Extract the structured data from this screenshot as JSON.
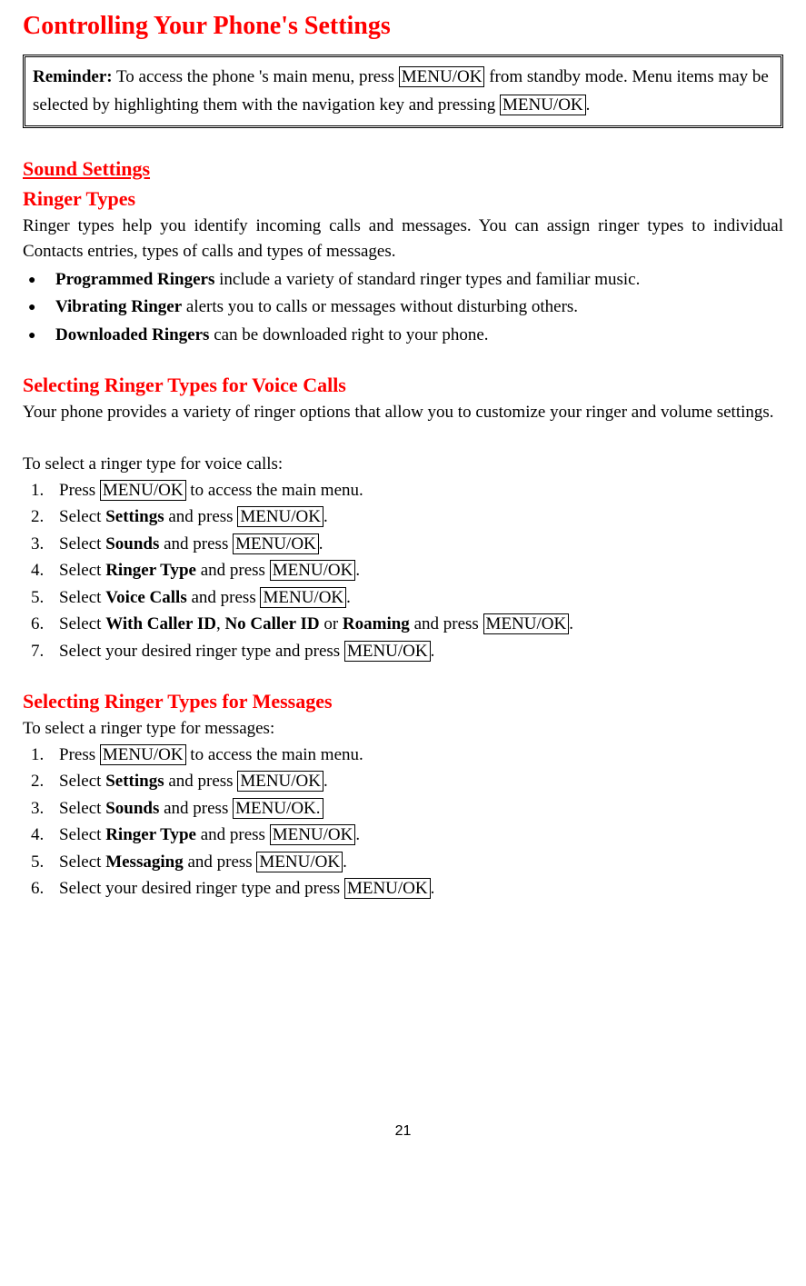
{
  "title": "Controlling Your Phone's Settings",
  "reminder": {
    "label": "Reminder:",
    "part1": " To access the phone 's main menu, press ",
    "key1": "MENU/OK",
    "part2": " from standby mode. Menu items may be selected by highlighting them with the navigation key and pressing ",
    "key2": "MENU/OK",
    "part3": "."
  },
  "sound_heading": "Sound Settings",
  "ringer_heading": "Ringer Types",
  "ringer_intro": "Ringer types help you identify incoming calls and messages. You can assign ringer types to individual Contacts entries, types of calls and types of messages.",
  "bullets": [
    {
      "bold": "Programmed Ringers",
      "rest": " include a variety of standard ringer types and familiar music."
    },
    {
      "bold": "Vibrating Ringer",
      "rest": " alerts you to calls or messages without disturbing others."
    },
    {
      "bold": "Downloaded Ringers",
      "rest": " can be downloaded right to your phone."
    }
  ],
  "voice_heading": "Selecting Ringer Types for Voice Calls",
  "voice_intro": "Your phone provides a variety of ringer options that allow you to customize your ringer and volume settings.",
  "voice_lead": "To select a ringer type for voice calls:",
  "voice_steps": {
    "s1a": "Press ",
    "s1k": "MENU/OK",
    "s1b": " to access the main menu.",
    "s2a": "Select ",
    "s2bold": "Settings",
    "s2b": " and press ",
    "s2k": "MENU/OK",
    "s2c": ".",
    "s3a": "Select ",
    "s3bold": "Sounds",
    "s3b": " and press ",
    "s3k": "MENU/OK",
    "s3c": ".",
    "s4a": "Select ",
    "s4bold": "Ringer Type",
    "s4b": " and press ",
    "s4k": "MENU/OK",
    "s4c": ".",
    "s5a": "Select ",
    "s5bold": "Voice Calls",
    "s5b": " and press ",
    "s5k": "MENU/OK",
    "s5c": ".",
    "s6a": "Select ",
    "s6b1": "With Caller ID",
    "s6m1": ", ",
    "s6b2": "No Caller ID",
    "s6m2": " or ",
    "s6b3": "Roaming",
    "s6m3": " and press ",
    "s6k": "MENU/OK",
    "s6c": ".",
    "s7a": "Select your desired ringer type and press ",
    "s7k": "MENU/OK",
    "s7b": "."
  },
  "msg_heading": "Selecting Ringer Types for Messages",
  "msg_lead": "To select a ringer type for messages:",
  "msg_steps": {
    "s1a": "Press ",
    "s1k": "MENU/OK",
    "s1b": " to access the main menu.",
    "s2a": "Select ",
    "s2bold": "Settings",
    "s2b": " and press ",
    "s2k": "MENU/OK",
    "s2c": ".",
    "s3a": "Select ",
    "s3bold": "Sounds",
    "s3b": " and press ",
    "s3k": "MENU/OK.",
    "s4a": "Select ",
    "s4bold": "Ringer Type",
    "s4b": " and press ",
    "s4k": "MENU/OK",
    "s4c": ".",
    "s5a": "Select ",
    "s5bold": "Messaging",
    "s5b": " and press ",
    "s5k": "MENU/OK",
    "s5c": ".",
    "s6a": "Select your desired ringer type and press ",
    "s6k": "MENU/OK",
    "s6b": "."
  },
  "page": "21"
}
